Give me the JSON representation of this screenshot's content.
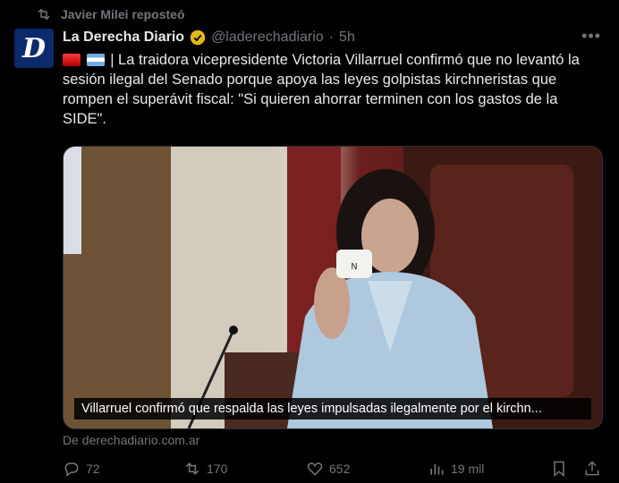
{
  "repost": {
    "text": "Javier Milei reposteó",
    "icon": "repost-icon"
  },
  "author": {
    "avatar_letter": "D",
    "name": "La Derecha Diario",
    "handle": "@laderechadiario",
    "separator": "·",
    "time": "5h",
    "verified_color": "#e2b719"
  },
  "post": {
    "text": "| La traidora vicepresidente Victoria Villarruel confirmó que no levantó la sesión ilegal del Senado porque apoya las leyes golpistas kirchneristas que rompen el superávit fiscal: \"Si quieren ahorrar terminen con los gastos de la SIDE\"."
  },
  "media": {
    "caption": "Villarruel confirmó que respalda las leyes impulsadas ilegalmente por el kirchn...",
    "cup_letter": "N"
  },
  "source": "De derechadiario.com.ar",
  "actions": {
    "replies": "72",
    "reposts": "170",
    "likes": "652",
    "views": "19 mil"
  },
  "colors": {
    "background": "#000000",
    "muted": "#71767b",
    "text": "#e7e9ea"
  }
}
